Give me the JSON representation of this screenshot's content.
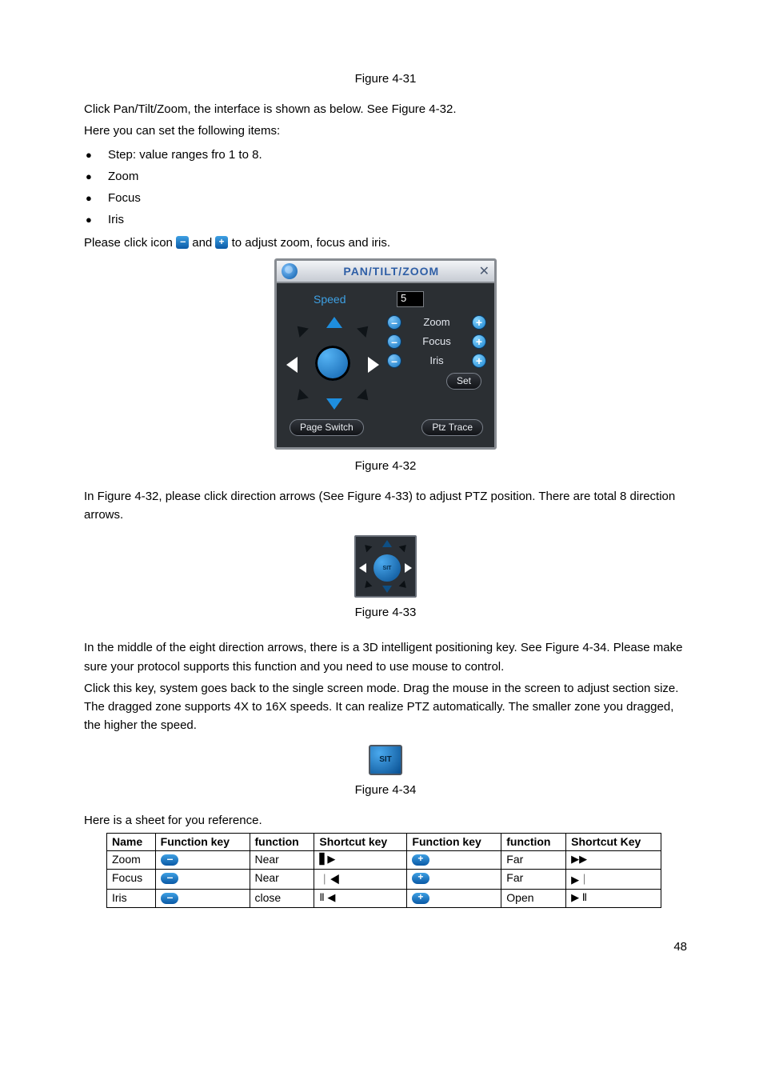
{
  "captions": {
    "fig431": "Figure 4-31",
    "fig432": "Figure 4-32",
    "fig433": "Figure 4-33",
    "fig434": "Figure 4-34"
  },
  "para": {
    "intro1": "Click Pan/Tilt/Zoom, the interface is shown as below. See Figure 4-32.",
    "intro2": "Here you can set the following items:",
    "b1": "Step: value ranges fro 1 to 8.",
    "b2": "Zoom",
    "b3": "Focus",
    "b4": "Iris",
    "click_pre": "Please click icon ",
    "click_mid": " and ",
    "click_post": " to adjust zoom, focus and iris.",
    "after432": "In Figure 4-32, please click direction arrows (See Figure 4-33) to adjust PTZ position. There are total 8 direction arrows.",
    "mid1": "In the middle of the eight direction arrows, there is a 3D intelligent positioning key. See Figure 4-34.  Please make sure your protocol supports this function and you need to use mouse to control.",
    "mid2": "Click this key, system goes back to the single screen mode. Drag the mouse in the screen to adjust section size.  The dragged zone supports 4X to 16X speeds. It can realize PTZ automatically. The smaller zone you dragged, the higher the speed.",
    "sheet_intro": "Here is a sheet for you reference."
  },
  "ptz": {
    "title": "PAN/TILT/ZOOM",
    "speed_label": "Speed",
    "speed_value": "5",
    "rows": {
      "zoom": "Zoom",
      "focus": "Focus",
      "iris": "Iris"
    },
    "set": "Set",
    "page_switch": "Page Switch",
    "ptz_trace": "Ptz Trace"
  },
  "sit_label": "SIT",
  "table": {
    "headers": [
      "Name",
      "Function key",
      "function",
      "Shortcut key",
      "Function key",
      "function",
      "Shortcut Key"
    ],
    "rows": [
      {
        "name": "Zoom",
        "f1": "Near",
        "s1": "▋▶",
        "f2": "Far",
        "s2": "▶▶"
      },
      {
        "name": "Focus",
        "f1": "Near",
        "s1": "｜◀",
        "f2": "Far",
        "s2": "▶｜"
      },
      {
        "name": "Iris",
        "f1": "close",
        "s1": "Ⅱ ◀",
        "f2": "Open",
        "s2": "▶ Ⅱ"
      }
    ]
  },
  "page_number": "48"
}
